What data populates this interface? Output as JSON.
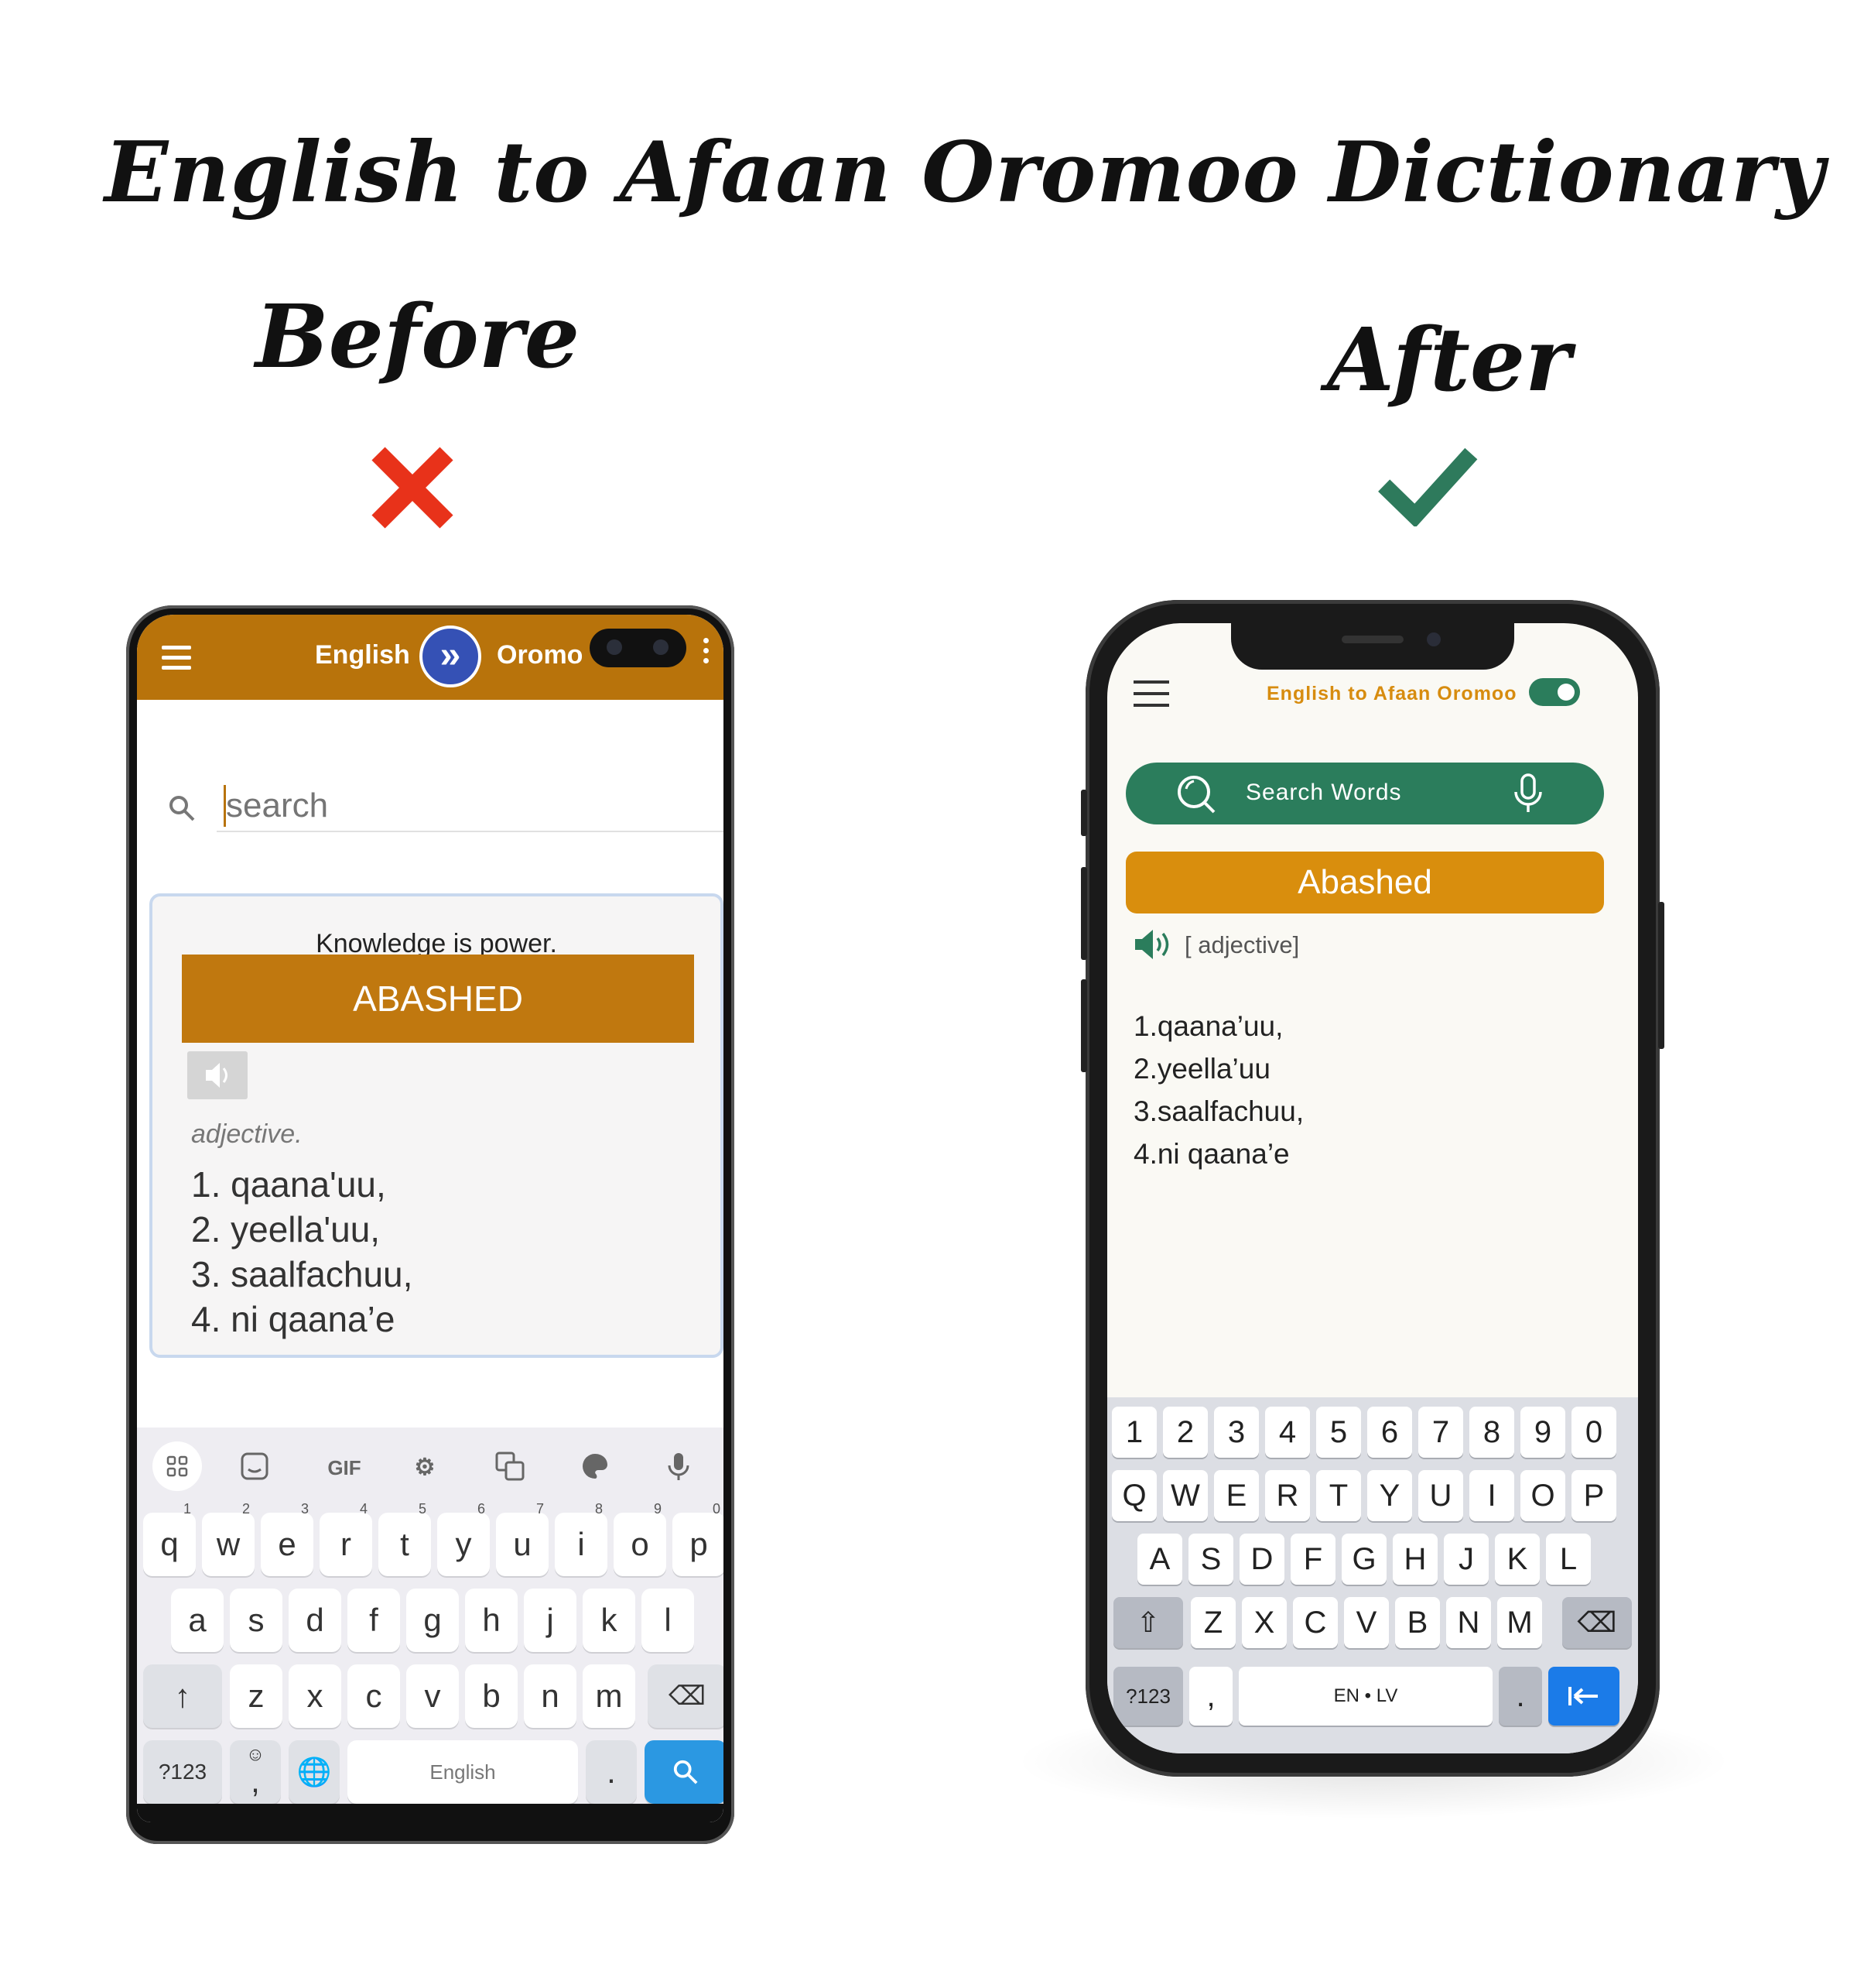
{
  "page": {
    "title": "English to Afaan Oromoo Dictionary",
    "before_label": "Before",
    "after_label": "After",
    "before_mark_icon": "x-icon",
    "after_mark_icon": "check-icon",
    "colors": {
      "x_mark": "#e8321a",
      "check_mark": "#2e7a5c"
    }
  },
  "before": {
    "header": {
      "source_lang": "English",
      "target_lang": "Oromo",
      "swap_icon": "double-chevron-right-icon",
      "color": "#b8730b"
    },
    "search": {
      "placeholder": "search"
    },
    "card": {
      "quote": "Knowledge is power.",
      "word": "ABASHED",
      "part_of_speech": "adjective.",
      "definitions": [
        "1. qaana'uu,",
        "2. yeella'uu,",
        "3. saalfachuu,",
        "4. ni qaana’e"
      ]
    },
    "keyboard": {
      "toolbar": [
        "apps-icon",
        "sticker-icon",
        "GIF",
        "settings-icon",
        "translate-icon",
        "palette-icon",
        "mic-icon"
      ],
      "gif_label": "GIF",
      "row1": [
        "q",
        "w",
        "e",
        "r",
        "t",
        "y",
        "u",
        "i",
        "o",
        "p"
      ],
      "row1_hints": [
        "1",
        "2",
        "3",
        "4",
        "5",
        "6",
        "7",
        "8",
        "9",
        "0"
      ],
      "row2": [
        "a",
        "s",
        "d",
        "f",
        "g",
        "h",
        "j",
        "k",
        "l"
      ],
      "row3": [
        "z",
        "x",
        "c",
        "v",
        "b",
        "n",
        "m"
      ],
      "mode_key": "?123",
      "comma_key": ",",
      "space_label": "English",
      "period_key": "."
    }
  },
  "after": {
    "header": {
      "title": "English to Afaan Oromoo",
      "toggle_on": true,
      "accent": "#2b7d5c",
      "title_color": "#d78c0f"
    },
    "search": {
      "label": "Search Words"
    },
    "word": "Abashed",
    "part_of_speech": "[ adjective]",
    "definitions": [
      "1.qaana’uu,",
      "2.yeella’uu",
      "3.saalfachuu,",
      "4.ni qaana’e"
    ],
    "keyboard": {
      "numbers": [
        "1",
        "2",
        "3",
        "4",
        "5",
        "6",
        "7",
        "8",
        "9",
        "0"
      ],
      "row1": [
        "Q",
        "W",
        "E",
        "R",
        "T",
        "Y",
        "U",
        "I",
        "O",
        "P"
      ],
      "row2": [
        "A",
        "S",
        "D",
        "F",
        "G",
        "H",
        "J",
        "K",
        "L"
      ],
      "row3": [
        "Z",
        "X",
        "C",
        "V",
        "B",
        "N",
        "M"
      ],
      "mode_key": "?123",
      "comma_key": ",",
      "space_label": "EN • LV",
      "period_key": "."
    }
  }
}
